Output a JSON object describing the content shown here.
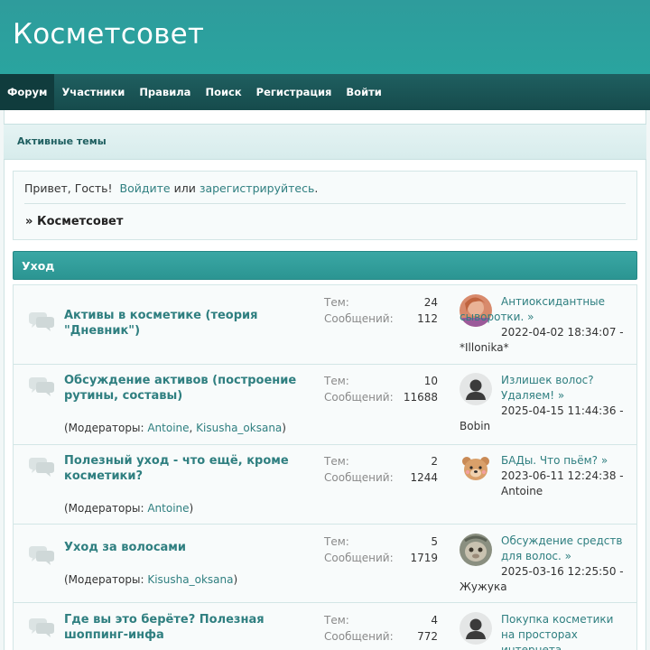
{
  "header": {
    "site_title": "Косметсовет"
  },
  "nav": {
    "items": [
      {
        "label": "Форум",
        "active": true
      },
      {
        "label": "Участники"
      },
      {
        "label": "Правила"
      },
      {
        "label": "Поиск"
      },
      {
        "label": "Регистрация"
      },
      {
        "label": "Войти"
      }
    ]
  },
  "active_topics": {
    "label": "Активные темы"
  },
  "greeting": {
    "hello": "Привет, Гость!",
    "login_link": "Войдите",
    "or": "или",
    "register_link": "зарегистрируйтесь",
    "period": "."
  },
  "breadcrumb": {
    "arrow": "»",
    "label": "Косметсовет"
  },
  "category": {
    "title": "Уход"
  },
  "boards": [
    {
      "title": "Активы в косметике (теория \"Дневник\")",
      "topics_label": "Тем:",
      "topics": "24",
      "posts_label": "Сообщений:",
      "posts": "112",
      "last_post_title": "Антиоксидантные сыворотки.",
      "last_post_arrow": "»",
      "last_post_date": "2022-04-02 18:34:07 -",
      "last_post_author": "*Illonika*",
      "avatar": "photo-woman"
    },
    {
      "title": "Обсуждение активов (построение рутины, составы)",
      "mods_prefix": "(Модераторы:",
      "mods": [
        "Antoine",
        "Kisusha_oksana"
      ],
      "mods_suffix": ")",
      "topics_label": "Тем:",
      "topics": "10",
      "posts_label": "Сообщений:",
      "posts": "11688",
      "last_post_title": "Излишек волос? Удаляем!",
      "last_post_arrow": "»",
      "last_post_date": "2025-04-15 11:44:36 -",
      "last_post_author": "Bobin",
      "avatar": "default-user"
    },
    {
      "title": "Полезный уход - что ещё, кроме косметики?",
      "mods_prefix": "(Модераторы:",
      "mods": [
        "Antoine"
      ],
      "mods_suffix": ")",
      "topics_label": "Тем:",
      "topics": "2",
      "posts_label": "Сообщений:",
      "posts": "1244",
      "last_post_title": "БАДы. Что пьём?",
      "last_post_arrow": "»",
      "last_post_date": "2023-06-11 12:24:38 -",
      "last_post_author": "Antoine",
      "avatar": "teddy-bear"
    },
    {
      "title": "Уход за волосами",
      "mods_prefix": "(Модераторы:",
      "mods": [
        "Kisusha_oksana"
      ],
      "mods_suffix": ")",
      "topics_label": "Тем:",
      "topics": "5",
      "posts_label": "Сообщений:",
      "posts": "1719",
      "last_post_title": "Обсуждение средств для волос.",
      "last_post_arrow": "»",
      "last_post_date": "2025-03-16 12:25:50 -",
      "last_post_author": "Жужука",
      "avatar": "photo-animal"
    },
    {
      "title": "Где вы это берёте? Полезная шоппинг-инфа",
      "topics_label": "Тем:",
      "topics": "4",
      "posts_label": "Сообщений:",
      "posts": "772",
      "last_post_title": "Покупка косметики на просторах интернета.",
      "last_post_arrow": "»",
      "avatar": "default-user"
    }
  ]
}
